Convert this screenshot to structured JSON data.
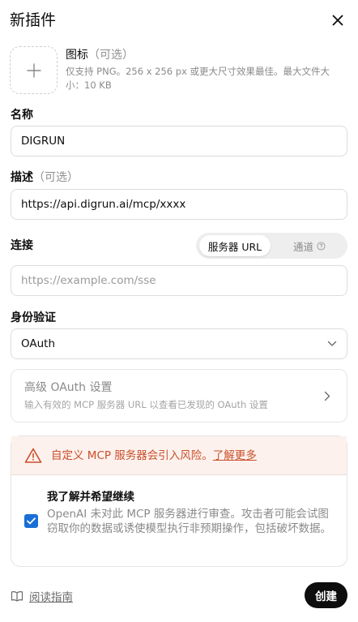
{
  "dialog": {
    "title": "新插件",
    "close_icon": "close-icon"
  },
  "icon_field": {
    "label": "图标",
    "optional": "（可选）",
    "help": "仅支持 PNG。256 x 256 px 或更大尺寸效果最佳。最大文件大小：10 KB",
    "upload_icon": "plus-icon"
  },
  "name_field": {
    "label": "名称",
    "value": "DIGRUN"
  },
  "description_field": {
    "label": "描述",
    "optional": "（可选）",
    "value": "https://api.digrun.ai/mcp/xxxx"
  },
  "connection": {
    "label": "连接",
    "tabs": [
      {
        "label": "服务器 URL",
        "selected": true
      },
      {
        "label": "通道",
        "selected": false,
        "icon": "help-circle-icon"
      }
    ],
    "url_placeholder": "https://example.com/sse",
    "url_value": ""
  },
  "auth": {
    "label": "身份验证",
    "selected": "OAuth"
  },
  "advanced_oauth": {
    "title": "高级 OAuth 设置",
    "subtitle": "输入有效的 MCP 服务器 URL 以查看已发现的 OAuth 设置"
  },
  "warning": {
    "text": "自定义 MCP 服务器会引入风险。",
    "link": "了解更多",
    "color": "#c94f2b",
    "background": "#fdf1ed"
  },
  "acknowledge": {
    "checked": true,
    "title": "我了解并希望继续",
    "body": "OpenAI 未对此 MCP 服务器进行审查。攻击者可能会试图窃取你的数据或诱使模型执行非预期操作，包括破坏数据。"
  },
  "footer": {
    "guide_label": "阅读指南",
    "create_label": "创建"
  },
  "colors": {
    "accent": "#1a6fd6",
    "primary_button": "#0d0d0d"
  }
}
